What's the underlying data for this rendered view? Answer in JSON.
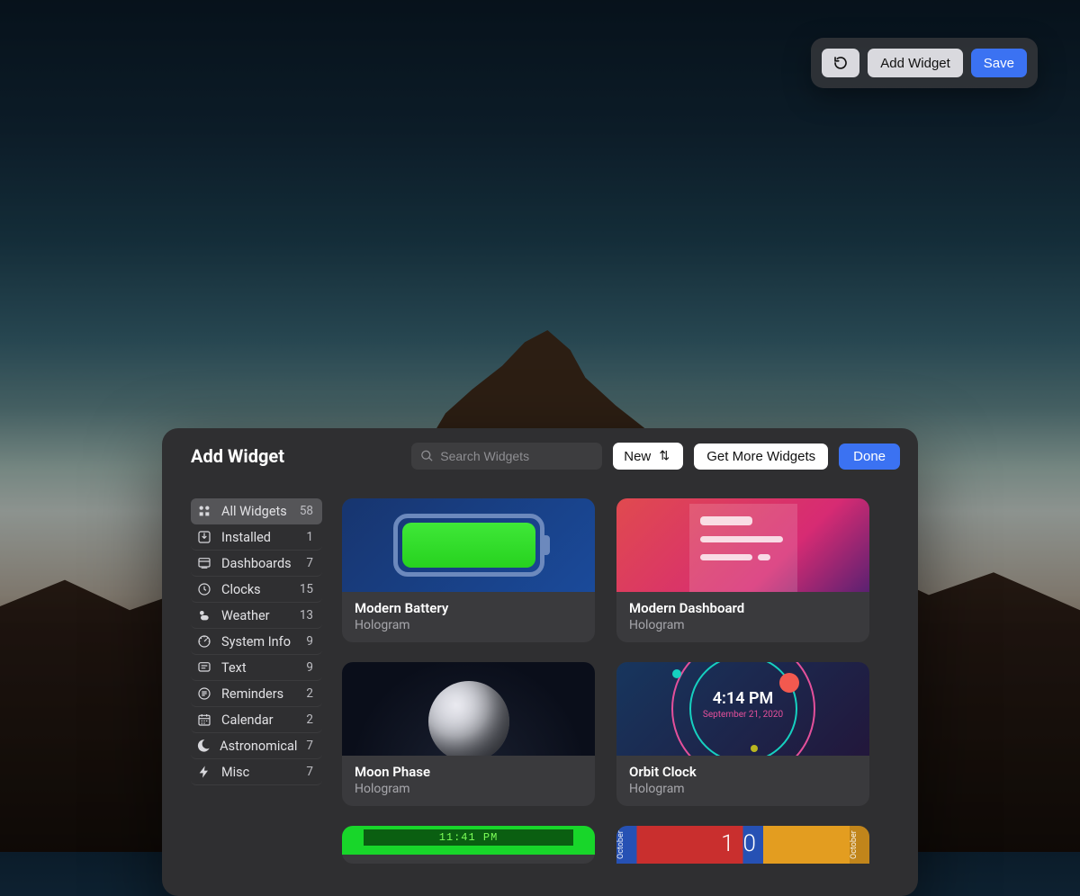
{
  "top_toolbar": {
    "refresh_icon": "↻",
    "add_widget_label": "Add Widget",
    "save_label": "Save"
  },
  "modal": {
    "title": "Add Widget",
    "search": {
      "placeholder": "Search Widgets"
    },
    "sort": {
      "label": "New",
      "arrows": "⇅"
    },
    "get_more_label": "Get More Widgets",
    "done_label": "Done"
  },
  "sidebar": {
    "items": [
      {
        "id": "all",
        "icon": "grid",
        "label": "All Widgets",
        "count": 58,
        "selected": true
      },
      {
        "id": "installed",
        "icon": "download",
        "label": "Installed",
        "count": 1,
        "selected": false
      },
      {
        "id": "dashboards",
        "icon": "dashboard",
        "label": "Dashboards",
        "count": 7,
        "selected": false
      },
      {
        "id": "clocks",
        "icon": "clock",
        "label": "Clocks",
        "count": 15,
        "selected": false
      },
      {
        "id": "weather",
        "icon": "weather",
        "label": "Weather",
        "count": 13,
        "selected": false
      },
      {
        "id": "system-info",
        "icon": "gauge",
        "label": "System Info",
        "count": 9,
        "selected": false
      },
      {
        "id": "text",
        "icon": "text",
        "label": "Text",
        "count": 9,
        "selected": false
      },
      {
        "id": "reminders",
        "icon": "list",
        "label": "Reminders",
        "count": 2,
        "selected": false
      },
      {
        "id": "calendar",
        "icon": "calendar",
        "label": "Calendar",
        "count": 2,
        "selected": false
      },
      {
        "id": "astronomical",
        "icon": "moon",
        "label": "Astronomical",
        "count": 7,
        "selected": false
      },
      {
        "id": "misc",
        "icon": "bolt",
        "label": "Misc",
        "count": 7,
        "selected": false
      }
    ]
  },
  "grid": {
    "cards": [
      {
        "id": "modern-battery",
        "name": "Modern Battery",
        "subtitle": "Hologram",
        "preview": "battery"
      },
      {
        "id": "modern-dashboard",
        "name": "Modern Dashboard",
        "subtitle": "Hologram",
        "preview": "dashboard"
      },
      {
        "id": "moon-phase",
        "name": "Moon Phase",
        "subtitle": "Hologram",
        "preview": "moon"
      },
      {
        "id": "orbit-clock",
        "name": "Orbit Clock",
        "subtitle": "Hologram",
        "preview": "orbit",
        "preview_meta": {
          "time": "4:14 PM",
          "date": "September 21, 2020"
        }
      },
      {
        "id": "retro-clock",
        "name": "",
        "subtitle": "",
        "preview": "retroclock",
        "partial": true,
        "preview_meta": {
          "time_text": "11:41 PM"
        }
      },
      {
        "id": "calendar-bar",
        "name": "",
        "subtitle": "",
        "preview": "calbar",
        "partial": true,
        "preview_meta": {
          "month": "October",
          "day": "10"
        }
      }
    ]
  }
}
